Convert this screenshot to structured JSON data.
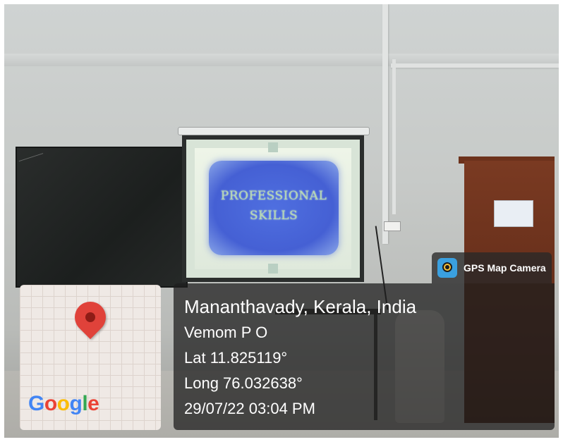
{
  "slide": {
    "line1": "PROFESSIONAL",
    "line2": "SKILLS"
  },
  "badge": {
    "label": "GPS Map Camera",
    "icon": "gps-map-camera-icon"
  },
  "location": {
    "place": "Mananthavady, Kerala, India",
    "area": "Vemom P O",
    "lat": "Lat 11.825119°",
    "long": "Long 76.032638°",
    "datetime": "29/07/22 03:04 PM"
  },
  "map": {
    "pin_icon": "map-pin-icon",
    "logo_text": "Google",
    "logo_letters": [
      "G",
      "o",
      "o",
      "g",
      "l",
      "e"
    ],
    "logo_colors": [
      "#4285F4",
      "#EA4335",
      "#FBBC05",
      "#4285F4",
      "#34A853",
      "#EA4335"
    ]
  }
}
